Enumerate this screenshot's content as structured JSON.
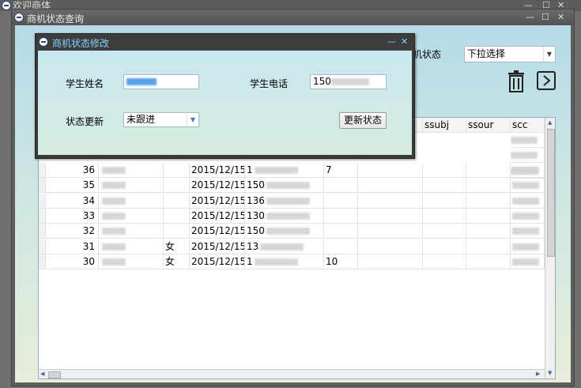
{
  "outer": {
    "title": "欢迎商体",
    "min": "—",
    "max": "☐",
    "close": "✕"
  },
  "window": {
    "title": "商机状态查询",
    "min": "—",
    "max": "☐",
    "close": "✕"
  },
  "filter": {
    "label": "机状态",
    "value": "下拉选择"
  },
  "icons": {
    "delete": "trash-icon",
    "next": "arrow-right-icon"
  },
  "grid": {
    "headers": [
      "ssubj",
      "ssour",
      "scc"
    ],
    "rows": [
      {
        "id": "36",
        "name": "",
        "gender": "",
        "date": "2015/12/15",
        "phone": "1",
        "tail": "7"
      },
      {
        "id": "35",
        "name": "",
        "gender": "",
        "date": "2015/12/15",
        "phone": "150",
        "tail": ""
      },
      {
        "id": "34",
        "name": "",
        "gender": "",
        "date": "2015/12/15",
        "phone": "136",
        "tail": ""
      },
      {
        "id": "33",
        "name": "",
        "gender": "",
        "date": "2015/12/15",
        "phone": "130",
        "tail": ""
      },
      {
        "id": "32",
        "name": "",
        "gender": "",
        "date": "2015/12/15",
        "phone": "150",
        "tail": ""
      },
      {
        "id": "31",
        "name": "",
        "gender": "女",
        "date": "2015/12/15",
        "phone": "13",
        "tail": ""
      },
      {
        "id": "30",
        "name": "",
        "gender": "女",
        "date": "2015/12/15",
        "phone": "1",
        "tail": "10"
      }
    ]
  },
  "dialog": {
    "title": "商机状态修改",
    "min": "—",
    "close": "✕",
    "name_label": "学生姓名",
    "name_value": "",
    "phone_label": "学生电话",
    "phone_value": "150",
    "status_label": "状态更新",
    "status_value": "未跟进",
    "update_button": "更新状态"
  }
}
